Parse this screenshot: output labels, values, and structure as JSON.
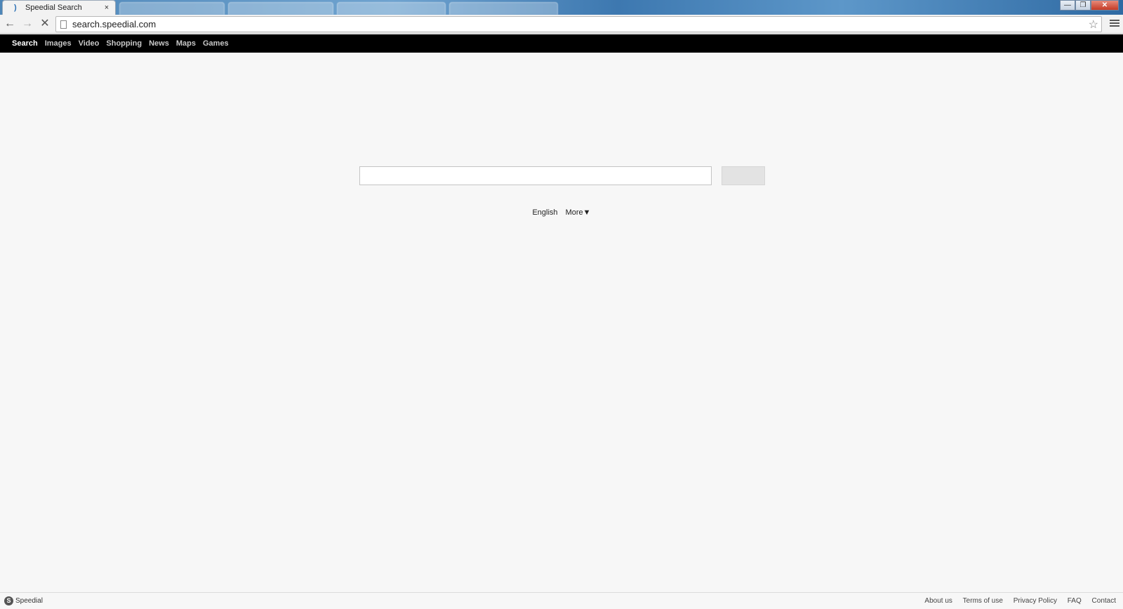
{
  "browser": {
    "active_tab_title": "Speedial Search",
    "tab_close_glyph": "×",
    "url": "search.speedial.com",
    "window_controls": {
      "minimize": "—",
      "maximize": "❐",
      "close": "✕"
    }
  },
  "toolbar": {
    "back_glyph": "←",
    "forward_glyph": "→",
    "stop_glyph": "✕",
    "star_glyph": "☆"
  },
  "nav": {
    "items": [
      {
        "label": "Search",
        "active": true
      },
      {
        "label": "Images",
        "active": false
      },
      {
        "label": "Video",
        "active": false
      },
      {
        "label": "Shopping",
        "active": false
      },
      {
        "label": "News",
        "active": false
      },
      {
        "label": "Maps",
        "active": false
      },
      {
        "label": "Games",
        "active": false
      }
    ]
  },
  "search": {
    "value": "",
    "placeholder": ""
  },
  "language": {
    "current": "English",
    "more": "More▼"
  },
  "footer": {
    "brand": "Speedial",
    "links": [
      "About us",
      "Terms of use",
      "Privacy Policy",
      "FAQ",
      "Contact"
    ]
  },
  "icons": {
    "favicon": "speedial-favicon-icon",
    "page": "page-icon",
    "bookmark": "star-icon",
    "menu": "hamburger-menu-icon"
  },
  "colors": {
    "nav_background": "#000000",
    "page_background": "#f7f7f7",
    "search_button": "#e3e3e3"
  }
}
